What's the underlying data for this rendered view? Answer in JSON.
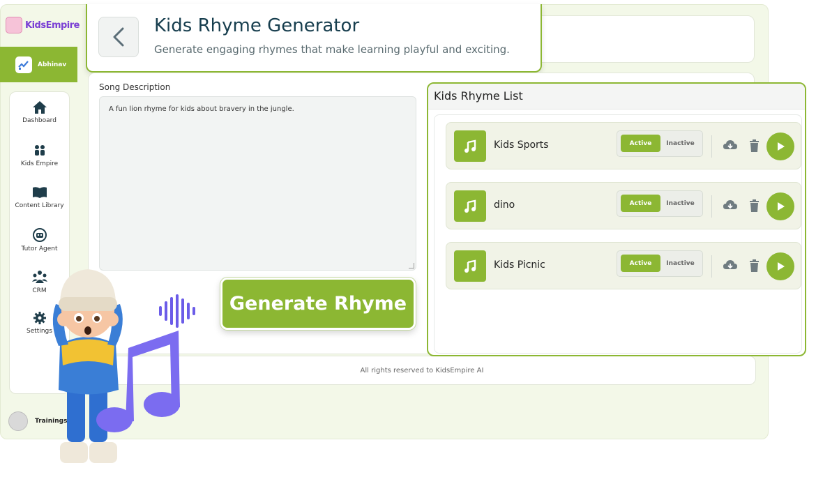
{
  "brand": {
    "logo_text": "KidsEmpire"
  },
  "user": {
    "name": "Abhinav"
  },
  "nav": {
    "items": [
      {
        "label": "Dashboard",
        "icon": "home-icon"
      },
      {
        "label": "Kids Empire",
        "icon": "kids-icon"
      },
      {
        "label": "Content Library",
        "icon": "book-icon"
      },
      {
        "label": "Tutor Agent",
        "icon": "robot-icon"
      },
      {
        "label": "CRM",
        "icon": "crm-icon"
      },
      {
        "label": "Settings",
        "icon": "gear-icon"
      }
    ],
    "trainings_label": "Trainings"
  },
  "header": {
    "title": "Kids Rhyme Generator",
    "subtitle": "Generate engaging rhymes that make learning playful and exciting."
  },
  "form": {
    "description_label": "Song Description",
    "description_value": "A fun lion rhyme for kids about bravery in the jungle.",
    "generate_label": "Generate Rhyme"
  },
  "rhyme_list": {
    "title": "Kids Rhyme List",
    "active_label": "Active",
    "inactive_label": "Inactive",
    "items": [
      {
        "name": "Kids Sports",
        "status": "Active"
      },
      {
        "name": "dino",
        "status": "Active"
      },
      {
        "name": "Kids Picnic",
        "status": "Active"
      }
    ]
  },
  "footer": {
    "text": "All rights reserved to KidsEmpire AI"
  },
  "colors": {
    "accent": "#8cb733",
    "title": "#173e4e",
    "music_note": "#7b6cf0"
  }
}
